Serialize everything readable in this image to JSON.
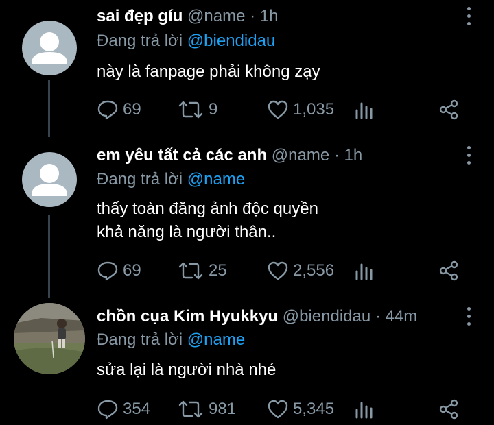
{
  "tweets": [
    {
      "name": "sai đẹp gíu",
      "handle": "@name",
      "dot": "·",
      "time": "1h",
      "reply_prefix": "Đang trả lời",
      "reply_to": "@biendidau",
      "body": [
        "này là fanpage phải không zạy"
      ],
      "replies": "69",
      "retweets": "9",
      "likes": "1,035"
    },
    {
      "name": "em yêu tất cả các anh",
      "handle": "@name",
      "dot": "·",
      "time": "1h",
      "reply_prefix": "Đang trả lời",
      "reply_to": "@name",
      "body": [
        "thấy toàn đăng ảnh độc quyền",
        "khả năng là người thân.."
      ],
      "replies": "69",
      "retweets": "25",
      "likes": "2,556"
    },
    {
      "name": "chồn cụa Kim Hyukkyu",
      "handle": "@biendidau",
      "dot": "·",
      "time": "44m",
      "reply_prefix": "Đang trả lời",
      "reply_to": "@name",
      "body": [
        "sửa lại là người nhà nhé"
      ],
      "replies": "354",
      "retweets": "981",
      "likes": "5,345"
    }
  ],
  "icons": [
    "reply-icon",
    "retweet-icon",
    "like-icon",
    "analytics-icon",
    "share-icon",
    "more-icon"
  ],
  "colors": {
    "background": "#000000",
    "muted": "#8899a6",
    "link": "#1da1f2",
    "avatar_default": "#aab8c2"
  }
}
